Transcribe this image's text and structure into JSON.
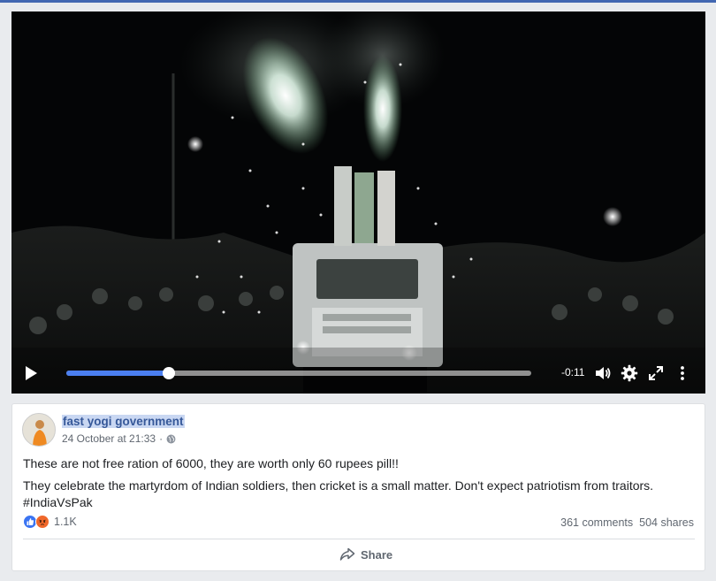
{
  "video": {
    "time_remaining": "-0:11",
    "progress": 0.22,
    "icons": {
      "play": "play-icon",
      "volume": "volume-icon",
      "settings": "gear-icon",
      "fullscreen": "expand-icon",
      "more": "more-vertical-icon"
    }
  },
  "post": {
    "author": "fast yogi government",
    "timestamp": "24 October at 21:33",
    "separator": "·",
    "privacy_icon": "globe-icon",
    "text_line1": "These are not free ration of 6000, they are worth only 60 rupees pill!!",
    "text_line2": "They celebrate the martyrdom of Indian soldiers, then cricket is a small matter. Don't expect patriotism from traitors.",
    "hashtag": "#IndiaVsPak",
    "reaction_count": "1.1K",
    "reaction_icons": [
      "like-icon",
      "angry-icon"
    ],
    "comments": "361 comments",
    "shares": "504 shares",
    "share_label": "Share"
  },
  "colors": {
    "top_strip": "#4267b2",
    "author_link": "#365899",
    "author_highlight": "#c9d7f2",
    "scrub_fill": "#4b7ff0",
    "background": "#e9ebee"
  }
}
